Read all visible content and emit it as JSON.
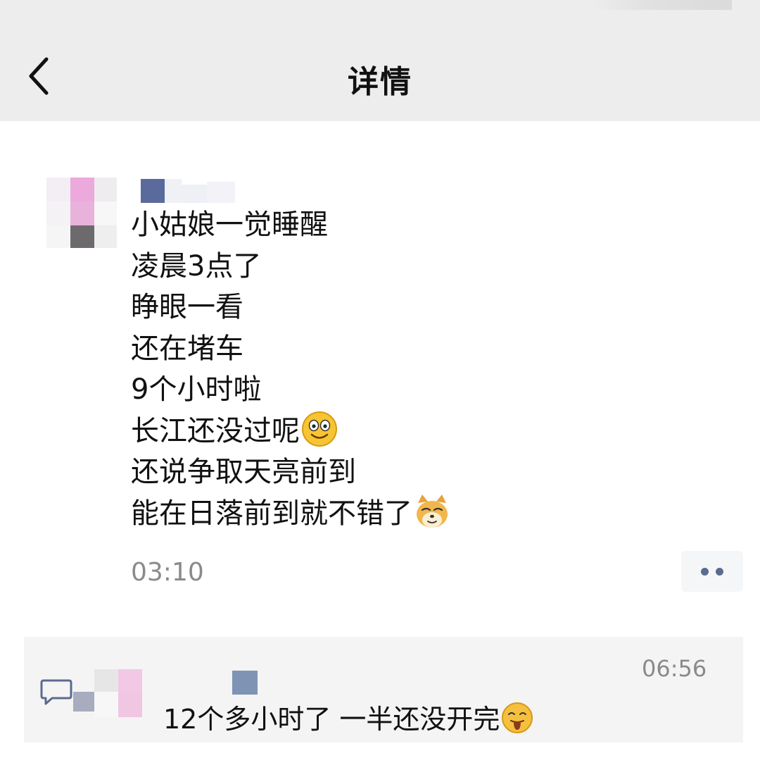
{
  "header": {
    "title": "详情",
    "back_icon": "chevron-left-icon"
  },
  "post": {
    "lines": [
      {
        "text": "小姑娘一觉睡醒",
        "emoji": ""
      },
      {
        "text": "凌晨3点了",
        "emoji": ""
      },
      {
        "text": "睁眼一看",
        "emoji": ""
      },
      {
        "text": "还在堵车",
        "emoji": ""
      },
      {
        "text": "9个小时啦",
        "emoji": ""
      },
      {
        "text": "长江还没过呢",
        "emoji": "smile-emoji"
      },
      {
        "text": "还说争取天亮前到",
        "emoji": ""
      },
      {
        "text": "能在日落前到就不错了",
        "emoji": "doge-emoji"
      }
    ],
    "time": "03:10",
    "action_icon": "more-dots-icon"
  },
  "comment": {
    "icon": "comment-bubble-icon",
    "time": "06:56",
    "text": "12个多小时了 一半还没开完",
    "emoji": "tongue-out-emoji"
  },
  "colors": {
    "header_bg": "#ededed",
    "link_blue": "#5b6b8f",
    "secondary_text": "#8a8a8a",
    "comment_bg": "#f4f4f4"
  }
}
